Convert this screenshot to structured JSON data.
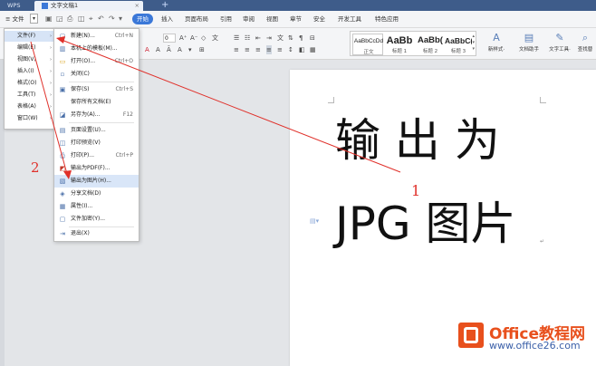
{
  "titlebar": {
    "app_name": "WPS",
    "doc_tab": "文字文稿1"
  },
  "menubar": {
    "file_label": "文件",
    "tabs": [
      "开始",
      "插入",
      "页面布局",
      "引用",
      "审阅",
      "视图",
      "章节",
      "安全",
      "开发工具",
      "特色应用"
    ]
  },
  "ribbon": {
    "font_size": "0",
    "styles": [
      {
        "preview": "AaBbCcDd",
        "caption": "正文"
      },
      {
        "preview": "AaBb",
        "caption": "标题 1"
      },
      {
        "preview": "AaBb(",
        "caption": "标题 2"
      },
      {
        "preview": "AaBbC(",
        "caption": "标题 3"
      }
    ],
    "new_style": "新样式·",
    "doc_helper": "文档助手",
    "text_tools": "文字工具·",
    "find_replace": "查找替"
  },
  "main_menu": [
    {
      "label": "文件(F)",
      "arrow": "›"
    },
    {
      "label": "编辑(E)",
      "arrow": "›"
    },
    {
      "label": "视图(V)",
      "arrow": "›"
    },
    {
      "label": "插入(I)",
      "arrow": "›"
    },
    {
      "label": "格式(O)",
      "arrow": "›"
    },
    {
      "label": "工具(T)",
      "arrow": "›"
    },
    {
      "label": "表格(A)",
      "arrow": "›"
    },
    {
      "label": "窗口(W)",
      "arrow": "›"
    }
  ],
  "file_submenu": [
    {
      "label": "新建(N)...",
      "shortcut": "Ctrl+N",
      "icon": "new-doc-icon"
    },
    {
      "label": "本机上的模板(M)...",
      "shortcut": "",
      "icon": "template-icon"
    },
    {
      "label": "打开(O)...",
      "shortcut": "Ctrl+O",
      "icon": "open-folder-icon"
    },
    {
      "label": "关闭(C)",
      "shortcut": "",
      "icon": "close-doc-icon"
    },
    {
      "label": "保存(S)",
      "shortcut": "Ctrl+S",
      "icon": "save-icon"
    },
    {
      "label": "保存所有文档(E)",
      "shortcut": "",
      "icon": "save-all-icon"
    },
    {
      "label": "另存为(A)...",
      "shortcut": "F12",
      "icon": "save-as-icon"
    },
    {
      "label": "页面设置(U)...",
      "shortcut": "",
      "icon": "page-setup-icon"
    },
    {
      "label": "打印预览(V)",
      "shortcut": "",
      "icon": "print-preview-icon"
    },
    {
      "label": "打印(P)...",
      "shortcut": "Ctrl+P",
      "icon": "print-icon"
    },
    {
      "label": "输出为PDF(F)...",
      "shortcut": "",
      "icon": "pdf-icon"
    },
    {
      "label": "输出为图片(H)...",
      "shortcut": "",
      "icon": "image-export-icon"
    },
    {
      "label": "分享文档(D)",
      "shortcut": "",
      "icon": "share-icon"
    },
    {
      "label": "属性(I)...",
      "shortcut": "",
      "icon": "properties-icon"
    },
    {
      "label": "文件加密(Y)...",
      "shortcut": "",
      "icon": "encrypt-icon"
    },
    {
      "label": "退出(X)",
      "shortcut": "",
      "icon": "exit-icon"
    }
  ],
  "document": {
    "line1": "输 出 为",
    "line2": "JPG 图片"
  },
  "annotations": {
    "step1": "1",
    "step2": "2",
    "color": "#e0312b"
  },
  "watermark": {
    "name": "Office教程网",
    "url": "www.office26.com"
  }
}
